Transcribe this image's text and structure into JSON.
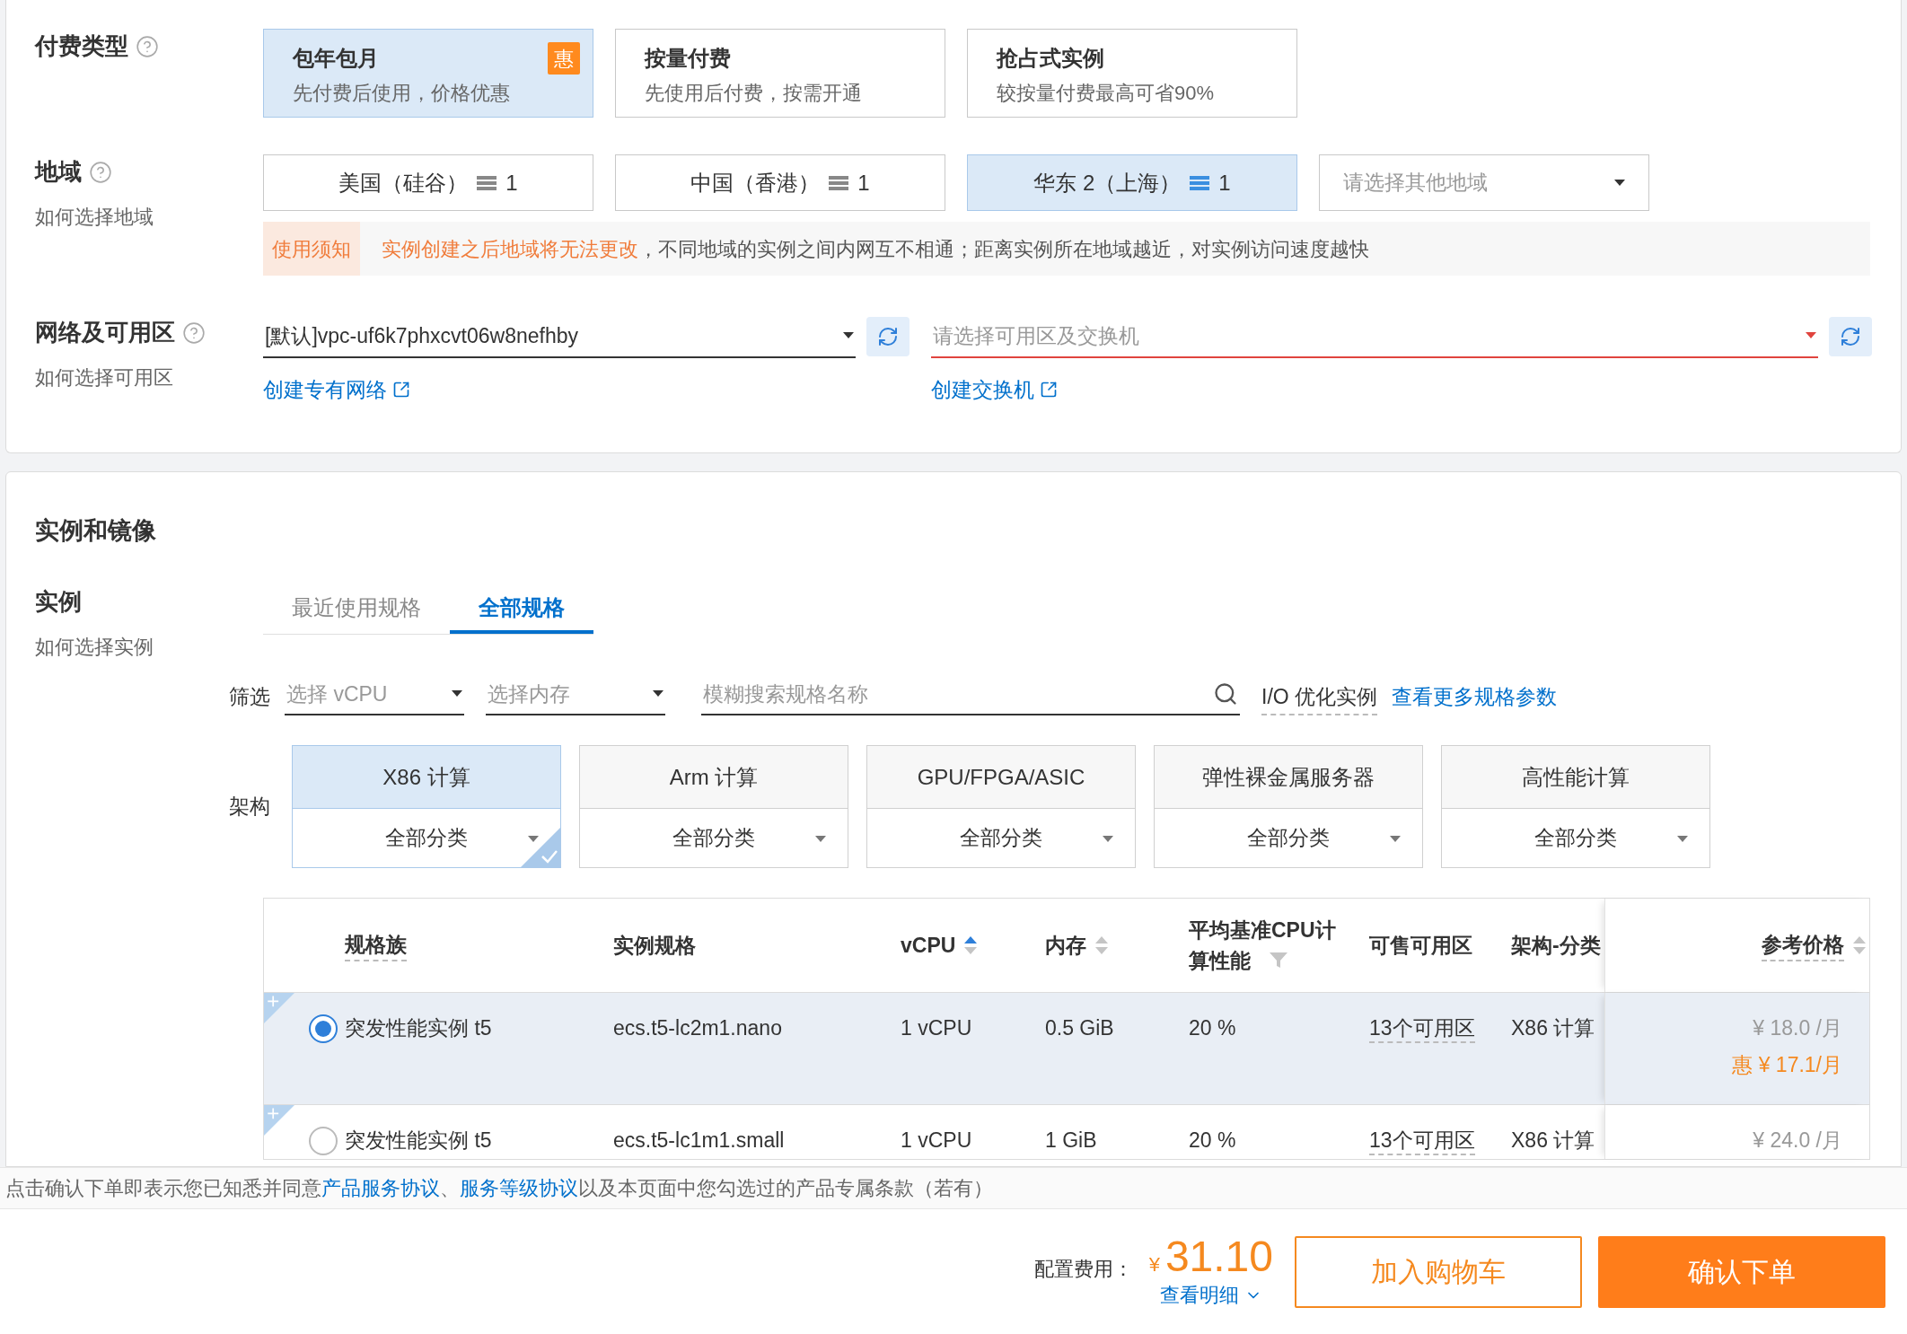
{
  "payment": {
    "label": "付费类型",
    "options": [
      {
        "title": "包年包月",
        "subtitle": "先付费后使用，价格优惠",
        "selected": true,
        "badge": "惠"
      },
      {
        "title": "按量付费",
        "subtitle": "先使用后付费，按需开通",
        "selected": false
      },
      {
        "title": "抢占式实例",
        "subtitle": "较按量付费最高可省90%",
        "selected": false
      }
    ]
  },
  "region": {
    "label": "地域",
    "help": "如何选择地域",
    "options": [
      {
        "name": "美国（硅谷）",
        "count": "1",
        "selected": false
      },
      {
        "name": "中国（香港）",
        "count": "1",
        "selected": false
      },
      {
        "name": "华东 2（上海）",
        "count": "1",
        "selected": true
      }
    ],
    "other_placeholder": "请选择其他地域",
    "notice": {
      "tag": "使用须知",
      "highlight": "实例创建之后地域将无法更改",
      "text": "，不同地域的实例之间内网互不相通；距离实例所在地域越近，对实例访问速度越快"
    }
  },
  "network": {
    "label": "网络及可用区",
    "help": "如何选择可用区",
    "vpc": {
      "value": "[默认]vpc-uf6k7phxcvt06w8nefhby",
      "link": "创建专有网络"
    },
    "vswitch": {
      "placeholder": "请选择可用区及交换机",
      "error": true,
      "link": "创建交换机"
    }
  },
  "instance_section": {
    "title": "实例和镜像",
    "label": "实例",
    "help": "如何选择实例",
    "tabs": [
      {
        "label": "最近使用规格",
        "selected": false
      },
      {
        "label": "全部规格",
        "selected": true
      }
    ],
    "filter": {
      "label": "筛选",
      "vcpu_placeholder": "选择 vCPU",
      "memory_placeholder": "选择内存",
      "search_placeholder": "模糊搜索规格名称",
      "io_label": "I/O 优化实例",
      "more_link": "查看更多规格参数"
    },
    "architecture": {
      "label": "架构",
      "options": [
        {
          "name": "X86 计算",
          "category": "全部分类",
          "selected": true
        },
        {
          "name": "Arm 计算",
          "category": "全部分类",
          "selected": false
        },
        {
          "name": "GPU/FPGA/ASIC",
          "category": "全部分类",
          "selected": false
        },
        {
          "name": "弹性裸金属服务器",
          "category": "全部分类",
          "selected": false
        },
        {
          "name": "高性能计算",
          "category": "全部分类",
          "selected": false
        }
      ]
    },
    "table": {
      "columns": [
        {
          "label": "规格族",
          "kind": "dashed"
        },
        {
          "label": "实例规格",
          "kind": "plain"
        },
        {
          "label": "vCPU",
          "kind": "sort_asc"
        },
        {
          "label": "内存",
          "kind": "sort"
        },
        {
          "label": "平均基准CPU计算性能",
          "kind": "filter"
        },
        {
          "label": "可售可用区",
          "kind": "plain"
        },
        {
          "label": "架构-分类",
          "kind": "plain"
        },
        {
          "label": "参考价格",
          "kind": "dashed_sort"
        }
      ],
      "rows": [
        {
          "selected": true,
          "family": "突发性能实例 t5",
          "spec": "ecs.t5-lc2m1.nano",
          "vcpu": "1 vCPU",
          "memory": "0.5 GiB",
          "cpu_perf": "20 %",
          "zones": "13个可用区",
          "arch": "X86 计算",
          "price": "¥ 18.0 /月",
          "discount_price": "惠 ¥ 17.1/月"
        },
        {
          "selected": false,
          "family": "突发性能实例 t5",
          "spec": "ecs.t5-lc1m1.small",
          "vcpu": "1 vCPU",
          "memory": "1 GiB",
          "cpu_perf": "20 %",
          "zones": "13个可用区",
          "arch": "X86 计算",
          "price": "¥ 24.0 /月"
        }
      ]
    }
  },
  "footer": {
    "agreement": {
      "before": "点击确认下单即表示您已知悉并同意",
      "link1": "产品服务协议",
      "sep": "、",
      "link2": "服务等级协议",
      "after": "以及本页面中您勾选过的产品专属条款（若有）"
    },
    "cost_label": "配置费用：",
    "currency": "¥",
    "amount": "31.10",
    "detail_link": "查看明细",
    "buttons": [
      {
        "label": "加入购物车",
        "kind": "secondary"
      },
      {
        "label": "确认下单",
        "kind": "primary"
      }
    ]
  }
}
